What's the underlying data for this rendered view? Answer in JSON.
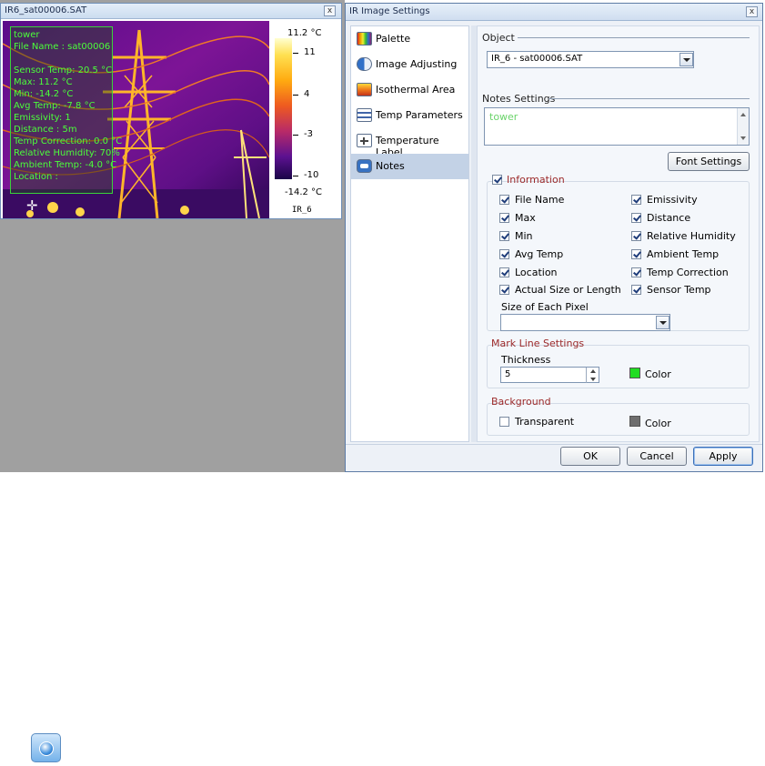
{
  "image_window": {
    "title": "IR6_sat00006.SAT",
    "close_glyph": "x",
    "notes": [
      "tower",
      "File Name : sat00006",
      "",
      "Sensor Temp: 20.5 °C",
      "Max: 11.2 °C",
      "Min: -14.2 °C",
      "Avg Temp: -7.8 °C",
      "Emissivity: 1",
      "Distance : 5m",
      "Temp Correction: 0.0 °C",
      "Relative Humidity: 70%",
      "Ambient Temp: -4.0 °C",
      "Location :"
    ],
    "scale": {
      "max_label": "11.2 °C",
      "min_label": "-14.2 °C",
      "ticks": [
        "11",
        "4",
        "-3",
        "-10"
      ],
      "tick_values": [
        11,
        4,
        -3,
        -10
      ],
      "range": [
        -14.2,
        11.2
      ],
      "id_label": "IR_6"
    }
  },
  "dialog": {
    "title": "IR Image Settings",
    "close_glyph": "x",
    "nav": [
      {
        "label": "Palette",
        "icon": "palette-icon"
      },
      {
        "label": "Image Adjusting",
        "icon": "image-adjust-icon"
      },
      {
        "label": "Isothermal Area",
        "icon": "isothermal-icon"
      },
      {
        "label": "Temp Parameters",
        "icon": "temp-params-icon"
      },
      {
        "label": "Temperature Label",
        "icon": "temp-label-icon"
      },
      {
        "label": "Notes",
        "icon": "notes-icon",
        "active": true
      }
    ],
    "object": {
      "title": "Object",
      "value": "IR_6 - sat00006.SAT"
    },
    "notes_settings": {
      "title": "Notes Settings",
      "text": "tower",
      "font_button": "Font Settings"
    },
    "information": {
      "label": "Information",
      "checked": true,
      "left_items": [
        "File Name",
        "Max",
        "Min",
        "Avg Temp",
        "Location",
        "Actual Size or Length"
      ],
      "right_items": [
        "Emissivity",
        "Distance",
        "Relative Humidity",
        "Ambient Temp",
        "Temp Correction",
        "Sensor Temp"
      ],
      "pixel_size_label": "Size of Each Pixel",
      "pixel_size_value": ""
    },
    "mark_line": {
      "title": "Mark Line Settings",
      "thickness_label": "Thickness",
      "thickness_value": "5",
      "color_label": "Color",
      "color": "#22dd22"
    },
    "background": {
      "title": "Background",
      "transparent_label": "Transparent",
      "transparent_checked": false,
      "color_label": "Color",
      "color": "#6e6e6e"
    },
    "buttons": {
      "ok": "OK",
      "cancel": "Cancel",
      "apply": "Apply"
    }
  }
}
